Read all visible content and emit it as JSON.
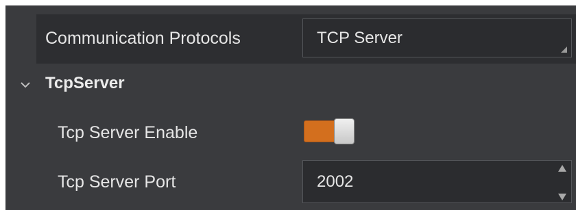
{
  "communication": {
    "label": "Communication Protocols",
    "value": "TCP Server"
  },
  "section": {
    "title": "TcpServer",
    "icon": "chevron-down-icon"
  },
  "tcp_server_enable": {
    "label": "Tcp Server Enable",
    "enabled": true
  },
  "tcp_server_port": {
    "label": "Tcp Server Port",
    "value": "2002"
  },
  "colors": {
    "panel": "#3a3b3e",
    "row_dark": "#2d2e31",
    "toggle_on": "#d36f1e",
    "text": "#e6e6e6"
  }
}
